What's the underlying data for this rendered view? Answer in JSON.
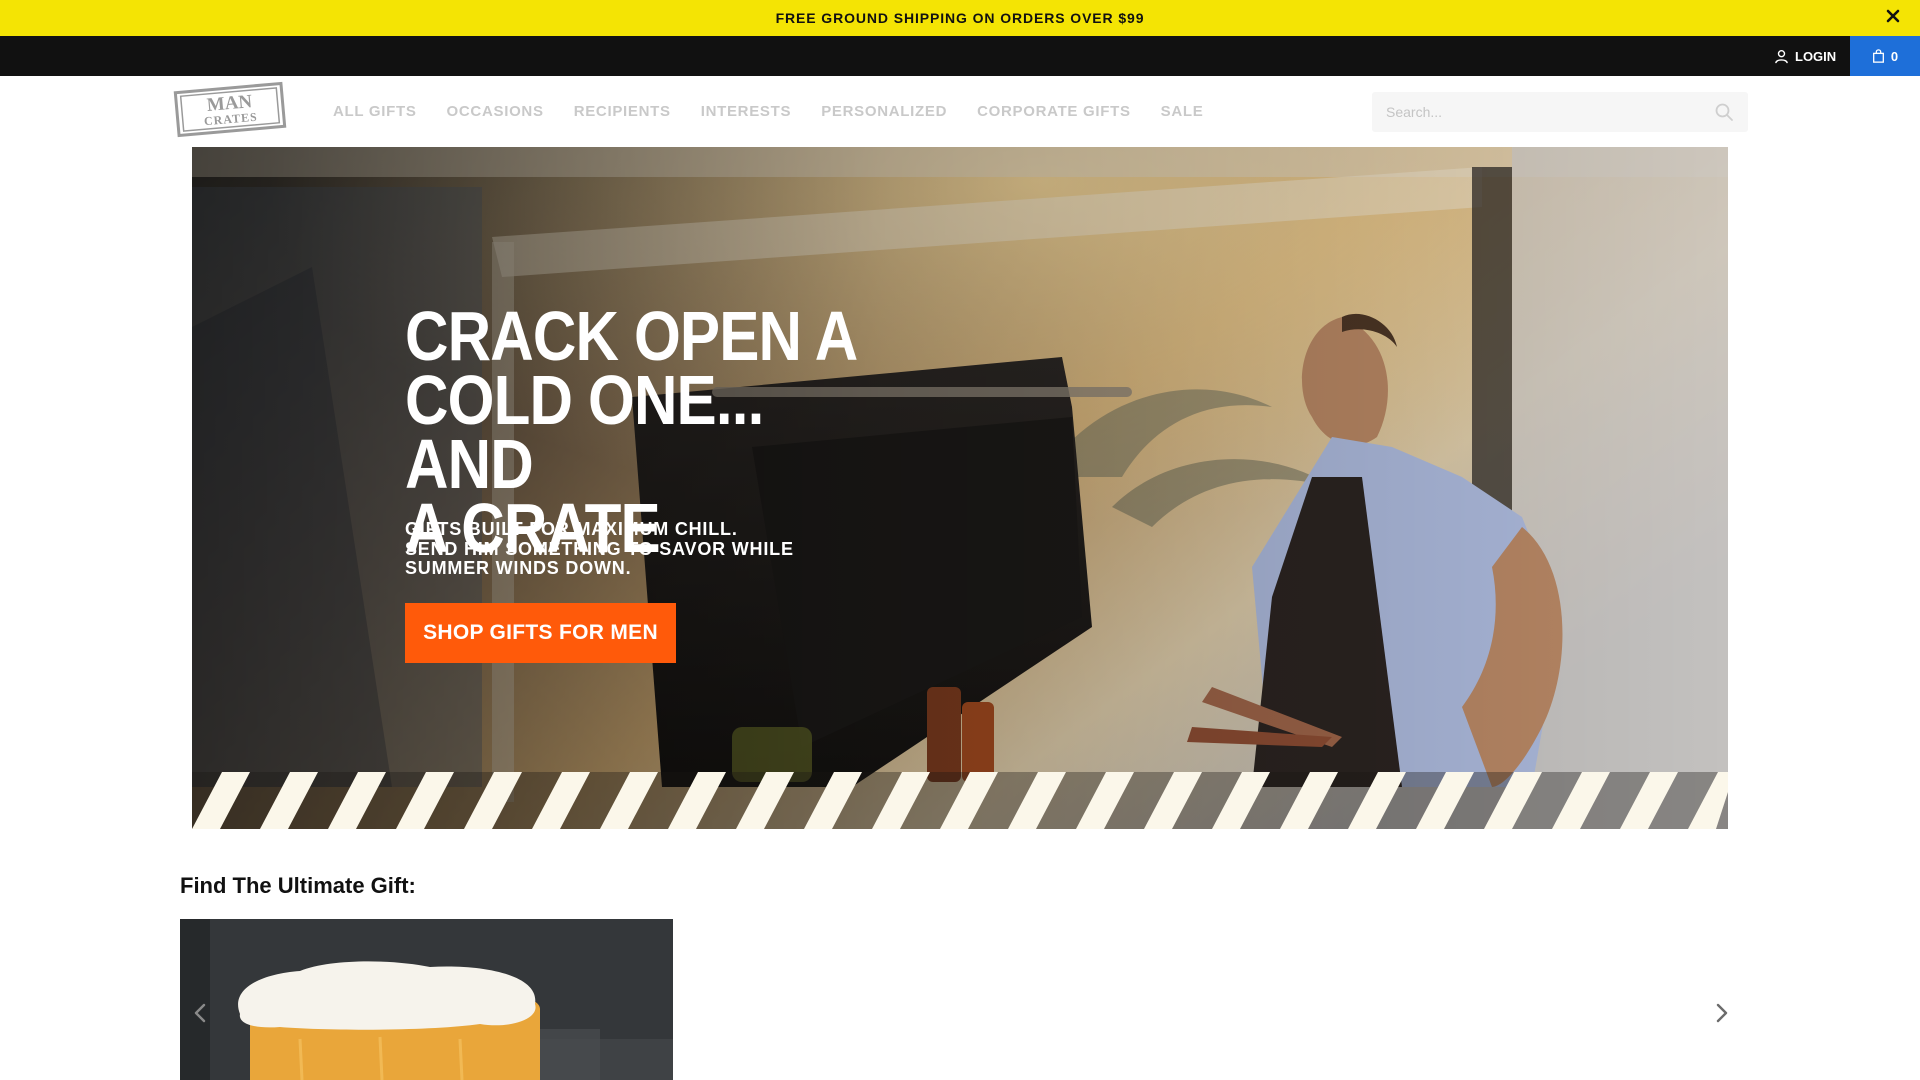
{
  "promo": {
    "text": "FREE GROUND SHIPPING ON ORDERS OVER $99",
    "close_icon": "close-icon"
  },
  "utility": {
    "login_label": "LOGIN",
    "cart_count": "0",
    "cart_color": "#1e6fd9"
  },
  "logo": {
    "line1": "MAN",
    "line2": "CRATES"
  },
  "nav": {
    "items": [
      {
        "label": "ALL GIFTS"
      },
      {
        "label": "OCCASIONS"
      },
      {
        "label": "RECIPIENTS"
      },
      {
        "label": "INTERESTS"
      },
      {
        "label": "PERSONALIZED"
      },
      {
        "label": "CORPORATE GIFTS"
      },
      {
        "label": "SALE"
      }
    ]
  },
  "search": {
    "placeholder": "Search..."
  },
  "hero": {
    "headline": "CRACK OPEN A\nCOLD ONE... AND\nA CRATE",
    "subtext": "GIFTS BUILT FOR MAXIMUM CHILL.\nSEND HIM SOMETHING TO SAVOR WHILE\nSUMMER WINDS DOWN.",
    "cta_label": "SHOP GIFTS FOR MEN",
    "cta_color": "#ff5a0a"
  },
  "gift_finder": {
    "title": "Find The Ultimate Gift:"
  },
  "colors": {
    "promo_bg": "#f4e404",
    "utility_bg": "#111111",
    "accent": "#ff5a0a"
  }
}
